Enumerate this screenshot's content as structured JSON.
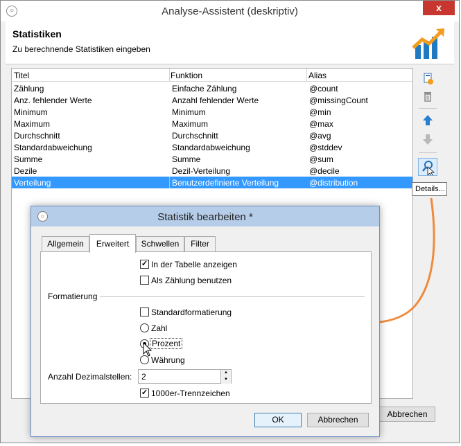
{
  "window": {
    "title": "Analyse-Assistent (deskriptiv)",
    "close_glyph": "x",
    "heading": "Statistiken",
    "subheading": "Zu berechnende Statistiken eingeben",
    "cancel_label": "Abbrechen"
  },
  "grid": {
    "columns": [
      "Titel",
      "Funktion",
      "Alias"
    ],
    "rows": [
      {
        "title": "Zählung",
        "function": "Einfache Zählung",
        "alias": "@count"
      },
      {
        "title": "Anz. fehlender Werte",
        "function": "Anzahl fehlender Werte",
        "alias": "@missingCount"
      },
      {
        "title": "Minimum",
        "function": "Minimum",
        "alias": "@min"
      },
      {
        "title": "Maximum",
        "function": "Maximum",
        "alias": "@max"
      },
      {
        "title": "Durchschnitt",
        "function": "Durchschnitt",
        "alias": "@avg"
      },
      {
        "title": "Standardabweichung",
        "function": "Standardabweichung",
        "alias": "@stddev"
      },
      {
        "title": "Summe",
        "function": "Summe",
        "alias": "@sum"
      },
      {
        "title": "Dezile",
        "function": "Dezil-Verteilung",
        "alias": "@decile"
      },
      {
        "title": "Verteilung",
        "function": "Benutzerdefinierte Verteilung",
        "alias": "@distribution"
      }
    ],
    "selected_row": "Verteilung"
  },
  "toolbar": {
    "tooltip": "Details...",
    "icons": [
      "add-icon",
      "delete-icon",
      "move-up-icon",
      "move-down-icon",
      "details-icon"
    ]
  },
  "dialog": {
    "title": "Statistik bearbeiten *",
    "tabs": [
      "Allgemein",
      "Erweitert",
      "Schwellen",
      "Filter"
    ],
    "active_tab": "Erweitert",
    "show_in_table_label": "In der Tabelle anzeigen",
    "show_in_table_checked": true,
    "use_as_count_label": "Als Zählung benutzen",
    "use_as_count_checked": false,
    "formatting_group": "Formatierung",
    "standard_format_label": "Standardformatierung",
    "standard_format_checked": false,
    "radio_options": [
      "Zahl",
      "Prozent",
      "Währung"
    ],
    "radio_selected": "Prozent",
    "decimals_label": "Anzahl Dezimalstellen:",
    "decimals_value": "2",
    "thousands_label": "1000er-Trennzeichen",
    "thousands_checked": true,
    "ok_label": "OK",
    "cancel_label": "Abbrechen"
  },
  "colors": {
    "selection": "#3399ff",
    "close_button": "#c7372f",
    "dialog_titlebar": "#b6cde9",
    "annotation_arrow": "#f08a3c"
  }
}
